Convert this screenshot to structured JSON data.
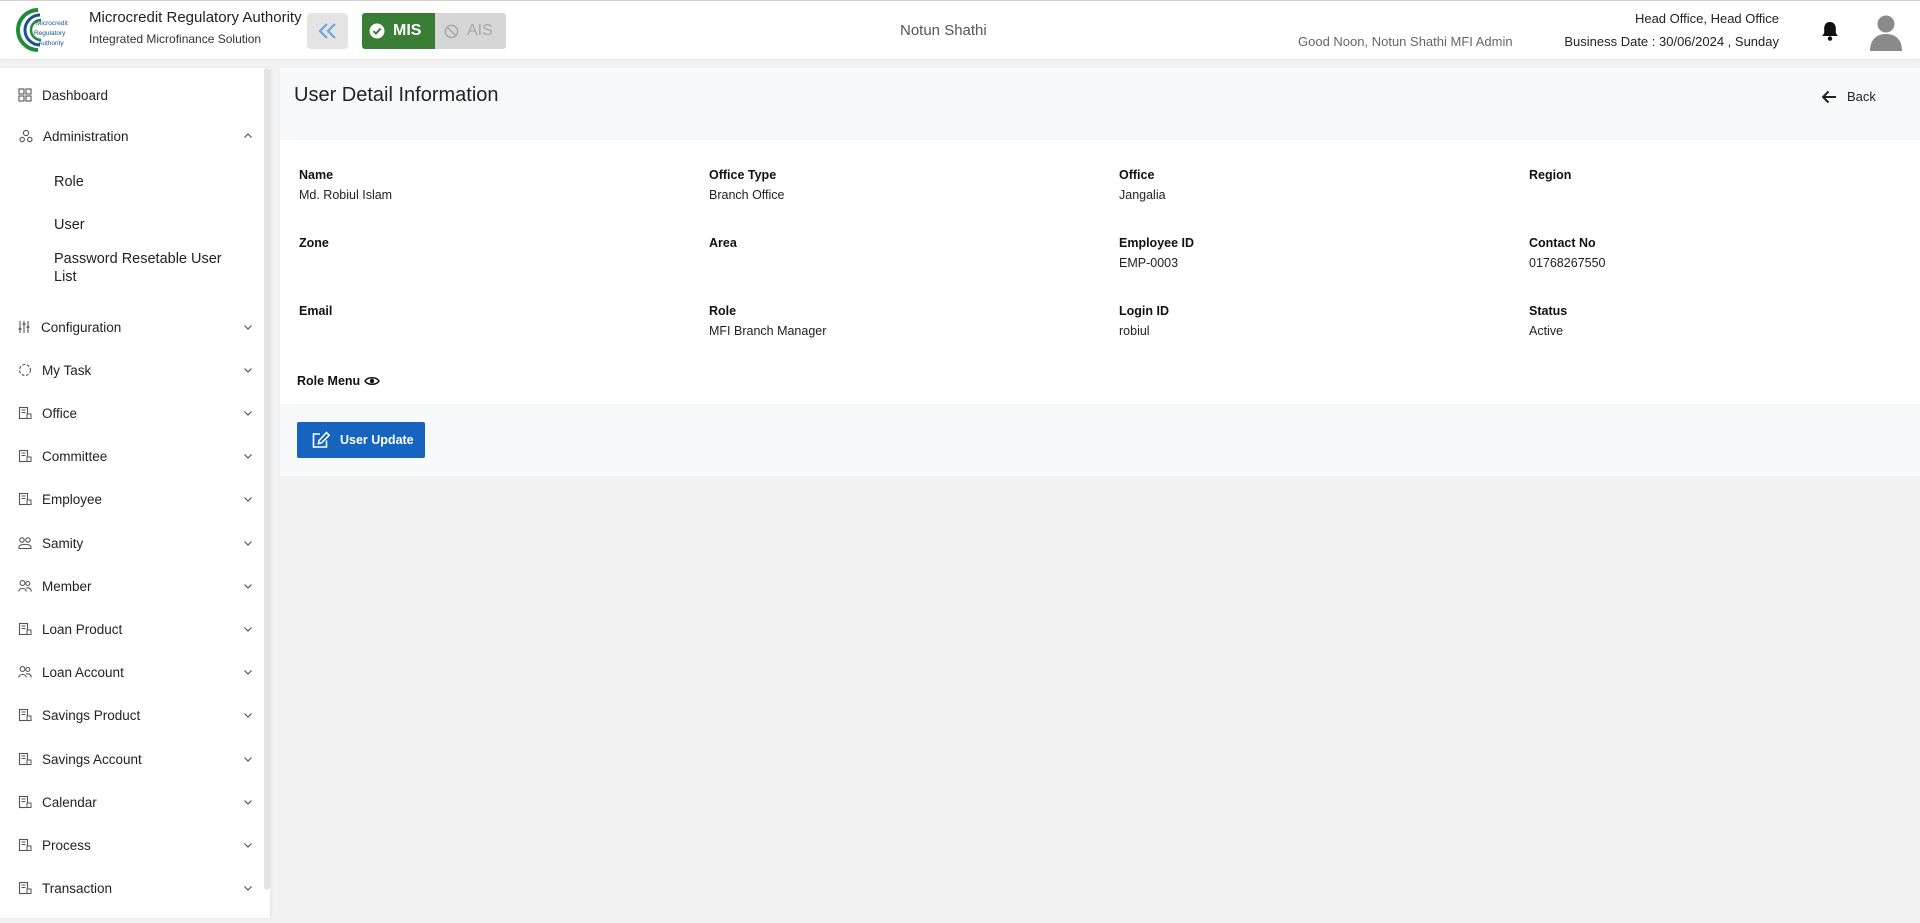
{
  "header": {
    "brand_title": "Microcredit Regulatory Authority",
    "brand_subtitle": "Integrated Microfinance Solution",
    "logo_text": [
      "Microcredit",
      "Regulatory",
      "Authority"
    ],
    "modes": [
      {
        "label": "MIS",
        "active": true
      },
      {
        "label": "AIS",
        "active": false
      }
    ],
    "mfi_name": "Notun Shathi",
    "greeting": "Good Noon, Notun Shathi MFI Admin",
    "office": "Head Office, Head Office",
    "business_date": "Business Date : 30/06/2024 , Sunday"
  },
  "sidebar": {
    "items": [
      {
        "label": "Dashboard",
        "icon": "dashboard-icon",
        "expandable": false
      },
      {
        "label": "Administration",
        "icon": "admin-icon",
        "expandable": true,
        "expanded": true
      },
      {
        "label": "Configuration",
        "icon": "sliders-icon",
        "expandable": true
      },
      {
        "label": "My Task",
        "icon": "task-icon",
        "expandable": true
      },
      {
        "label": "Office",
        "icon": "office-icon",
        "expandable": true
      },
      {
        "label": "Committee",
        "icon": "committee-icon",
        "expandable": true
      },
      {
        "label": "Employee",
        "icon": "employee-icon",
        "expandable": true
      },
      {
        "label": "Samity",
        "icon": "samity-icon",
        "expandable": true
      },
      {
        "label": "Member",
        "icon": "member-icon",
        "expandable": true
      },
      {
        "label": "Loan Product",
        "icon": "loan-product-icon",
        "expandable": true
      },
      {
        "label": "Loan Account",
        "icon": "loan-account-icon",
        "expandable": true
      },
      {
        "label": "Savings Product",
        "icon": "savings-product-icon",
        "expandable": true
      },
      {
        "label": "Savings Account",
        "icon": "savings-account-icon",
        "expandable": true
      },
      {
        "label": "Calendar",
        "icon": "calendar-icon",
        "expandable": true
      },
      {
        "label": "Process",
        "icon": "process-icon",
        "expandable": true
      },
      {
        "label": "Transaction",
        "icon": "transaction-icon",
        "expandable": true
      }
    ],
    "admin_subitems": [
      "Role",
      "User",
      "Password Resetable User List"
    ]
  },
  "page": {
    "title": "User Detail Information",
    "back_label": "Back",
    "fields": [
      {
        "label": "Name",
        "value": "Md. Robiul Islam"
      },
      {
        "label": "Office Type",
        "value": "Branch Office"
      },
      {
        "label": "Office",
        "value": "Jangalia"
      },
      {
        "label": "Region",
        "value": ""
      },
      {
        "label": "Zone",
        "value": ""
      },
      {
        "label": "Area",
        "value": ""
      },
      {
        "label": "Employee ID",
        "value": "EMP-0003"
      },
      {
        "label": "Contact No",
        "value": "01768267550"
      },
      {
        "label": "Email",
        "value": ""
      },
      {
        "label": "Role",
        "value": "MFI Branch Manager"
      },
      {
        "label": "Login ID",
        "value": "robiul"
      },
      {
        "label": "Status",
        "value": "Active"
      }
    ],
    "role_menu_label": "Role Menu",
    "update_button_label": "User Update"
  },
  "colors": {
    "mis_green": "#3a7d35",
    "primary_blue": "#1565c0",
    "logo_green": "#1f8a3a",
    "logo_blue": "#1d4f91"
  }
}
